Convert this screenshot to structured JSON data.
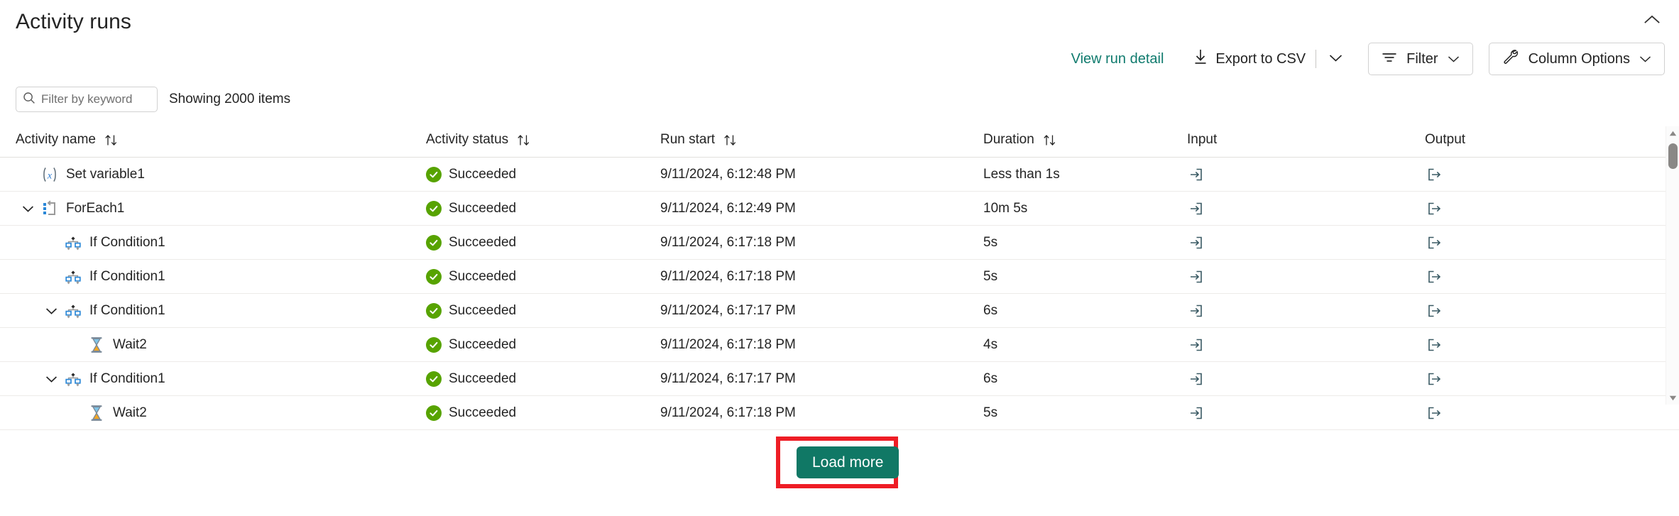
{
  "header": {
    "title": "Activity runs",
    "collapse_icon": "chevron-up-icon"
  },
  "commandbar": {
    "view_run_detail": "View run detail",
    "export_csv": "Export to CSV",
    "export_icon": "download-icon",
    "export_caret_icon": "chevron-down-icon",
    "filter": "Filter",
    "filter_icon": "filter-lines-icon",
    "filter_caret_icon": "chevron-down-icon",
    "column_options": "Column Options",
    "column_options_icon": "wrench-icon",
    "column_options_caret_icon": "chevron-down-icon"
  },
  "filterrow": {
    "search_placeholder": "Filter by keyword",
    "search_value": "",
    "search_icon": "search-icon",
    "showing": "Showing 2000 items"
  },
  "table": {
    "columns": [
      {
        "label": "Activity name",
        "sortable": true,
        "sort_icon": "sort-arrows-icon"
      },
      {
        "label": "Activity status",
        "sortable": true,
        "sort_icon": "sort-arrows-icon"
      },
      {
        "label": "Run start",
        "sortable": true,
        "sort_icon": "sort-arrows-icon"
      },
      {
        "label": "Duration",
        "sortable": true,
        "sort_icon": "sort-arrows-icon"
      },
      {
        "label": "Input",
        "sortable": false,
        "sort_icon": ""
      },
      {
        "label": "Output",
        "sortable": false,
        "sort_icon": ""
      }
    ],
    "input_icon": "arrow-into-box-icon",
    "output_icon": "arrow-out-of-box-icon",
    "status_icon": "success-check-circle-icon",
    "status_color": "#57a300",
    "rows": [
      {
        "name": "Set variable1",
        "icon": "set-variable-icon",
        "indent": 0,
        "expander": "none",
        "status": "Succeeded",
        "run_start": "9/11/2024, 6:12:48 PM",
        "duration": "Less than 1s"
      },
      {
        "name": "ForEach1",
        "icon": "foreach-loop-icon",
        "indent": 0,
        "expander": "expanded",
        "status": "Succeeded",
        "run_start": "9/11/2024, 6:12:49 PM",
        "duration": "10m 5s"
      },
      {
        "name": "If Condition1",
        "icon": "if-condition-icon",
        "indent": 1,
        "expander": "none",
        "status": "Succeeded",
        "run_start": "9/11/2024, 6:17:18 PM",
        "duration": "5s"
      },
      {
        "name": "If Condition1",
        "icon": "if-condition-icon",
        "indent": 1,
        "expander": "none",
        "status": "Succeeded",
        "run_start": "9/11/2024, 6:17:18 PM",
        "duration": "5s"
      },
      {
        "name": "If Condition1",
        "icon": "if-condition-icon",
        "indent": 1,
        "expander": "expanded",
        "status": "Succeeded",
        "run_start": "9/11/2024, 6:17:17 PM",
        "duration": "6s"
      },
      {
        "name": "Wait2",
        "icon": "wait-hourglass-icon",
        "indent": 2,
        "expander": "none",
        "status": "Succeeded",
        "run_start": "9/11/2024, 6:17:18 PM",
        "duration": "4s"
      },
      {
        "name": "If Condition1",
        "icon": "if-condition-icon",
        "indent": 1,
        "expander": "expanded",
        "status": "Succeeded",
        "run_start": "9/11/2024, 6:17:17 PM",
        "duration": "6s"
      },
      {
        "name": "Wait2",
        "icon": "wait-hourglass-icon",
        "indent": 2,
        "expander": "none",
        "status": "Succeeded",
        "run_start": "9/11/2024, 6:17:18 PM",
        "duration": "5s"
      }
    ]
  },
  "scrollbar": {
    "up_icon": "scroll-up-arrow-icon",
    "down_icon": "scroll-down-arrow-icon"
  },
  "footer": {
    "load_more": "Load more",
    "load_more_color": "#107865",
    "highlight_color": "#ee1d25"
  }
}
